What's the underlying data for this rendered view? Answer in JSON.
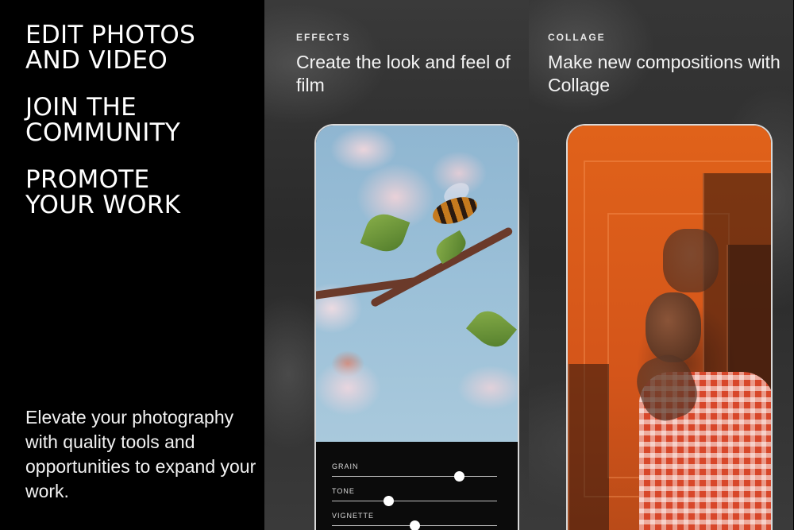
{
  "left": {
    "headlines": [
      "EDIT PHOTOS\nAND VIDEO",
      "JOIN THE\nCOMMUNITY",
      "PROMOTE\nYOUR WORK"
    ],
    "tagline": "Elevate your photography with quality tools and opportunities to expand your work."
  },
  "effects": {
    "kicker": "EFFECTS",
    "subhead": "Create the look and feel of film",
    "sliders": [
      {
        "label": "GRAIN",
        "value": 0.77
      },
      {
        "label": "TONE",
        "value": 0.34
      },
      {
        "label": "VIGNETTE",
        "value": 0.5
      }
    ]
  },
  "collage": {
    "kicker": "COLLAGE",
    "subhead": "Make new compositions with Collage"
  },
  "colors": {
    "background": "#000000",
    "accent_orange": "#e0621a",
    "sky_blue": "#9bc0d8"
  }
}
